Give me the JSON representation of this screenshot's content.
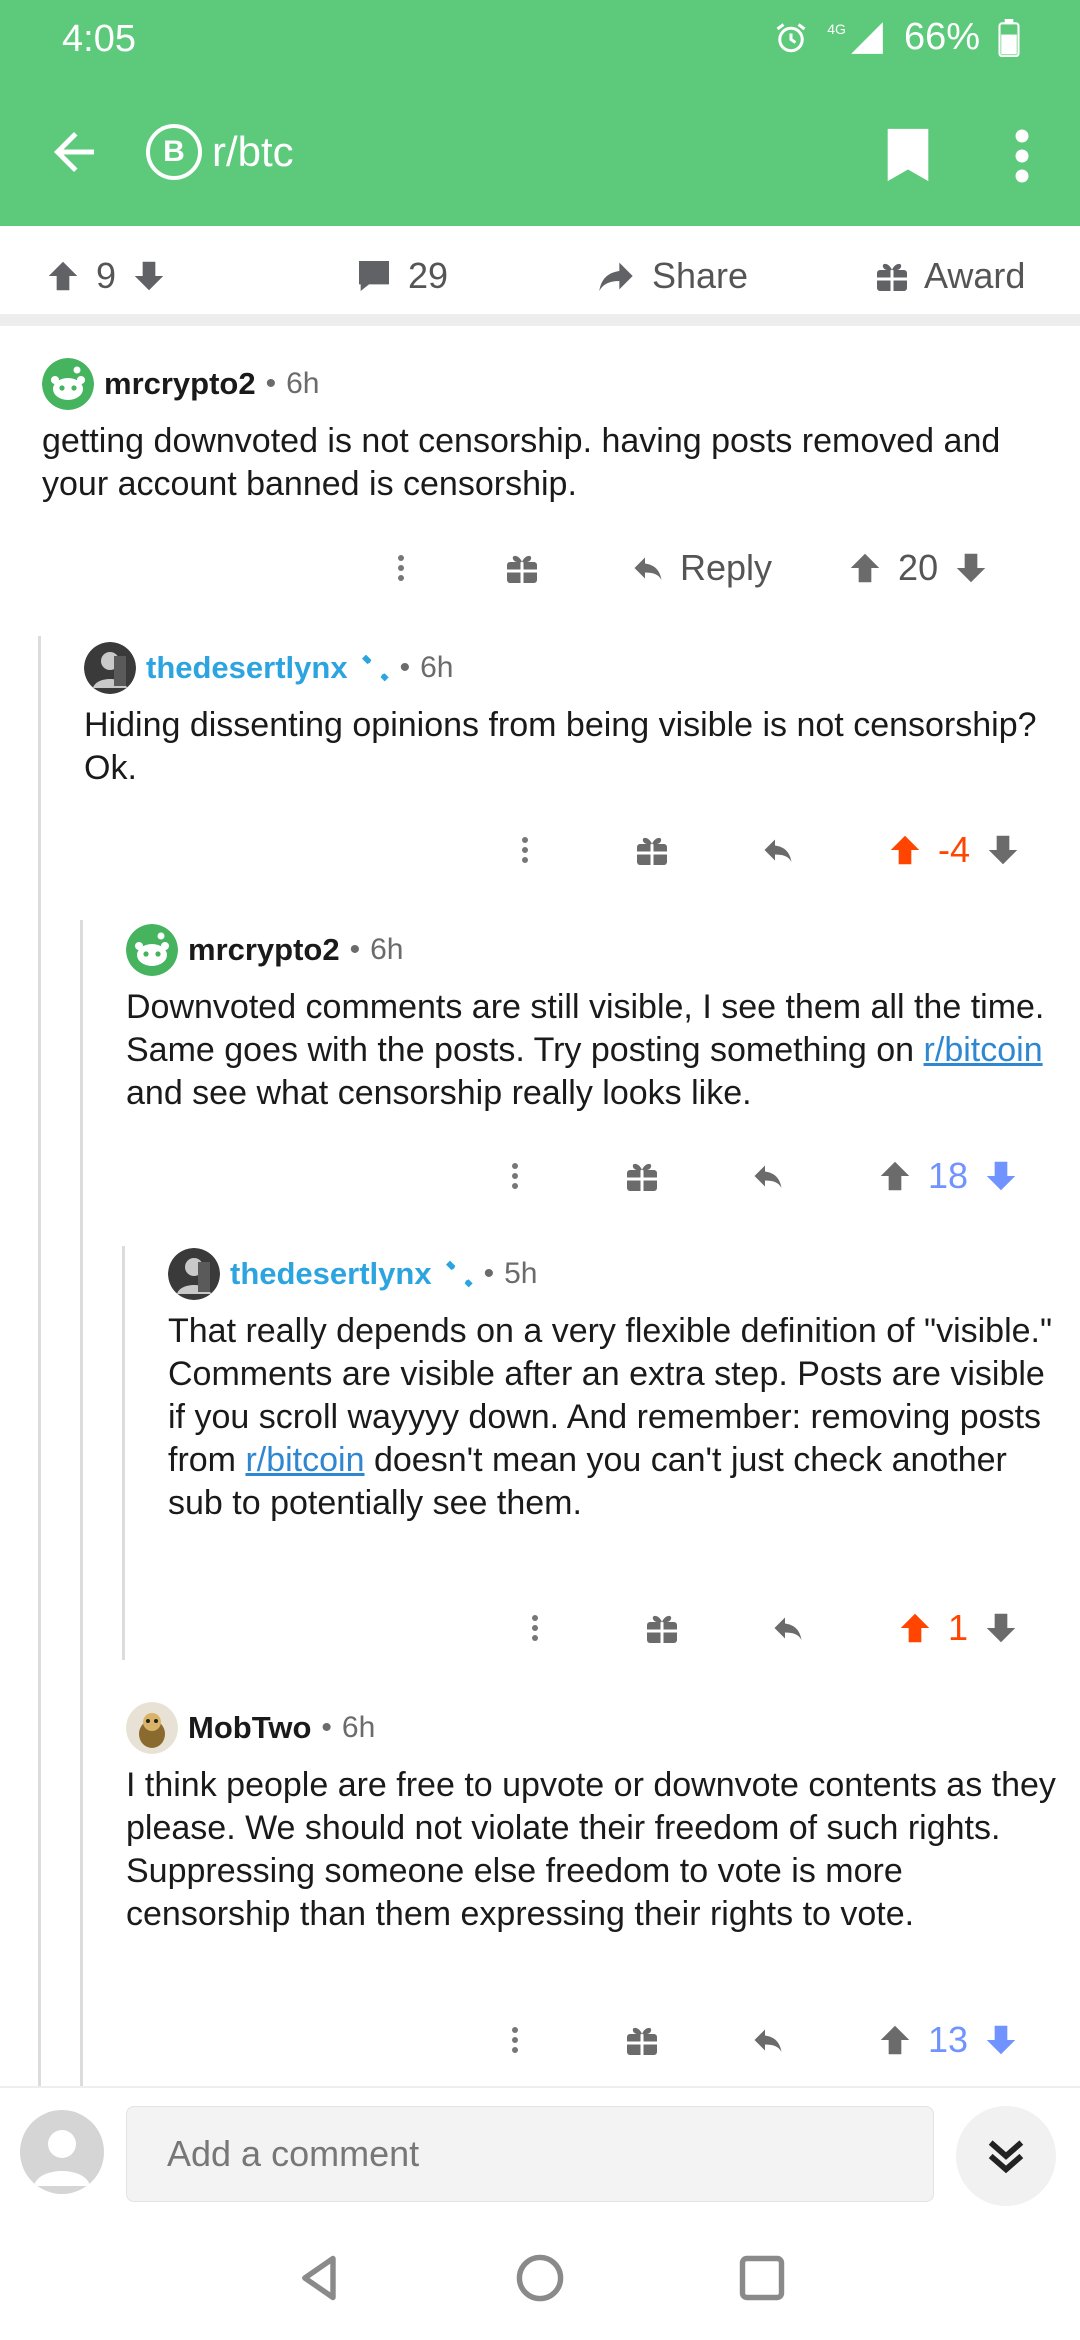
{
  "status_bar": {
    "time": "4:05",
    "network": "4G",
    "battery": "66%"
  },
  "header": {
    "subreddit": "r/btc",
    "sub_icon": "B",
    "bg_color": "#5dc97b"
  },
  "post_actions": {
    "score": "9",
    "comments": "29",
    "share": "Share",
    "award": "Award"
  },
  "comments": [
    {
      "author": "mrcrypto2",
      "time": "6h",
      "mod": false,
      "body_parts": [
        "getting downvoted is not censorship.  having posts removed and your account banned is censorship."
      ],
      "reply_label": "Reply",
      "score": "20",
      "vote": "none"
    },
    {
      "author": "thedesertlynx",
      "time": "6h",
      "mod": true,
      "body_parts": [
        "Hiding dissenting opinions from being visible is not censorship? Ok."
      ],
      "score": "-4",
      "vote": "up"
    },
    {
      "author": "mrcrypto2",
      "time": "6h",
      "mod": false,
      "body_parts": [
        "Downvoted comments are still visible, I see them all the time.  Same goes with the posts.  Try posting something on ",
        "r/bitcoin",
        " and see what censorship really looks like."
      ],
      "score": "18",
      "vote": "down"
    },
    {
      "author": "thedesertlynx",
      "time": "5h",
      "mod": true,
      "body_parts": [
        "That really depends on a very flexible definition of \"visible.\" Comments are visible after an extra step. Posts are visible if you scroll wayyyy down. And remember: removing posts from ",
        "r/bitcoin",
        " doesn't mean you can't just check another sub to potentially see them."
      ],
      "score": "1",
      "vote": "up"
    },
    {
      "author": "MobTwo",
      "time": "6h",
      "mod": false,
      "body_parts": [
        "I think people are free to upvote or downvote contents as they please. We should not violate their freedom of such rights.  Suppressing someone else freedom to vote is more censorship than them expressing their rights to vote."
      ],
      "score": "13",
      "vote": "down"
    }
  ],
  "composer": {
    "placeholder": "Add a comment"
  },
  "colors": {
    "upvote": "#ff4500",
    "downvote": "#7193ff",
    "link": "#2e87d0",
    "mod_name": "#2ca4e0"
  }
}
